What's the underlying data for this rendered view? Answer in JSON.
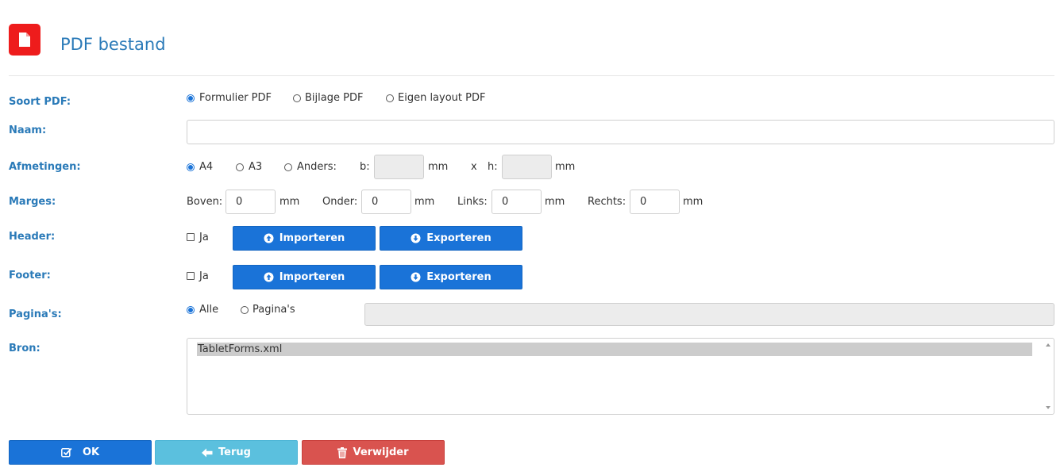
{
  "header": {
    "title": "PDF bestand",
    "icon": "file-pdf-icon",
    "icon_color": "#ee1c1c"
  },
  "form": {
    "soort": {
      "label": "Soort PDF:",
      "options": [
        "Formulier PDF",
        "Bijlage PDF",
        "Eigen layout PDF"
      ],
      "selected": "Formulier PDF"
    },
    "naam": {
      "label": "Naam:",
      "value": ""
    },
    "afmetingen": {
      "label": "Afmetingen:",
      "options": [
        "A4",
        "A3",
        "Anders:"
      ],
      "selected": "A4",
      "b_label": "b:",
      "b_value": "",
      "unit1": "mm",
      "x": "x",
      "h_label": "h:",
      "h_value": "",
      "unit2": "mm"
    },
    "marges": {
      "label": "Marges:",
      "boven_label": "Boven:",
      "boven_value": "0",
      "onder_label": "Onder:",
      "onder_value": "0",
      "links_label": "Links:",
      "links_value": "0",
      "rechts_label": "Rechts:",
      "rechts_value": "0",
      "unit": "mm"
    },
    "header": {
      "label": "Header:",
      "check_label": "Ja",
      "checked": false,
      "import_label": "Importeren",
      "export_label": "Exporteren"
    },
    "footer": {
      "label": "Footer:",
      "check_label": "Ja",
      "checked": false,
      "import_label": "Importeren",
      "export_label": "Exporteren"
    },
    "paginas": {
      "label": "Pagina's:",
      "options": [
        "Alle",
        "Pagina's"
      ],
      "selected": "Alle",
      "value": ""
    },
    "bron": {
      "label": "Bron:",
      "items": [
        "TabletForms.xml"
      ],
      "selected": "TabletForms.xml"
    }
  },
  "actions": {
    "ok_label": "OK",
    "back_label": "Terug",
    "delete_label": "Verwijder"
  },
  "colors": {
    "primary": "#1a73d8",
    "label": "#2a7ab8",
    "info": "#5bc0de",
    "danger": "#d9534f"
  }
}
